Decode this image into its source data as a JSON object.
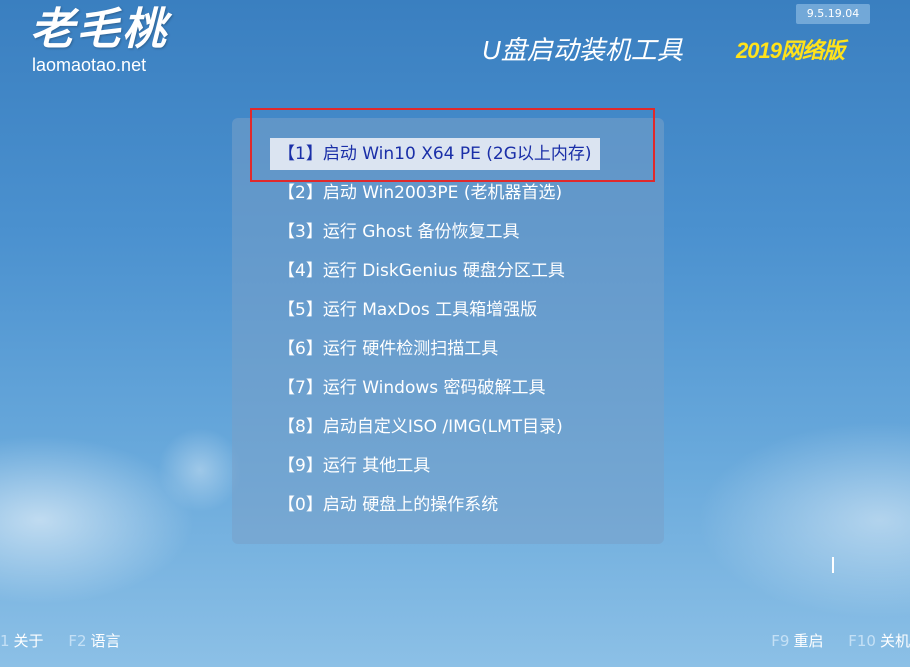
{
  "brand": {
    "logo": "老毛桃",
    "site": "laomaotao.net",
    "product": "U盘启动装机工具",
    "edition": "2019网络版",
    "version": "9.5.19.04"
  },
  "menu": {
    "items": [
      {
        "label": "【1】启动 Win10 X64 PE (2G以上内存)"
      },
      {
        "label": "【2】启动 Win2003PE (老机器首选)"
      },
      {
        "label": "【3】运行 Ghost 备份恢复工具"
      },
      {
        "label": "【4】运行 DiskGenius 硬盘分区工具"
      },
      {
        "label": "【5】运行 MaxDos 工具箱增强版"
      },
      {
        "label": "【6】运行 硬件检测扫描工具"
      },
      {
        "label": "【7】运行 Windows 密码破解工具"
      },
      {
        "label": "【8】启动自定义ISO /IMG(LMT目录)"
      },
      {
        "label": "【9】运行 其他工具"
      },
      {
        "label": "【0】启动 硬盘上的操作系统"
      }
    ],
    "selected_index": 0
  },
  "footer": {
    "left": [
      {
        "key": "1",
        "label": "关于"
      },
      {
        "key": "F2",
        "label": "语言"
      }
    ],
    "right": [
      {
        "key": "F9",
        "label": "重启"
      },
      {
        "key": "F10",
        "label": "关机"
      }
    ]
  },
  "colors": {
    "highlight_border": "#e0292b",
    "selected_text": "#1a2fa8",
    "edition_text": "#ffe21a"
  }
}
